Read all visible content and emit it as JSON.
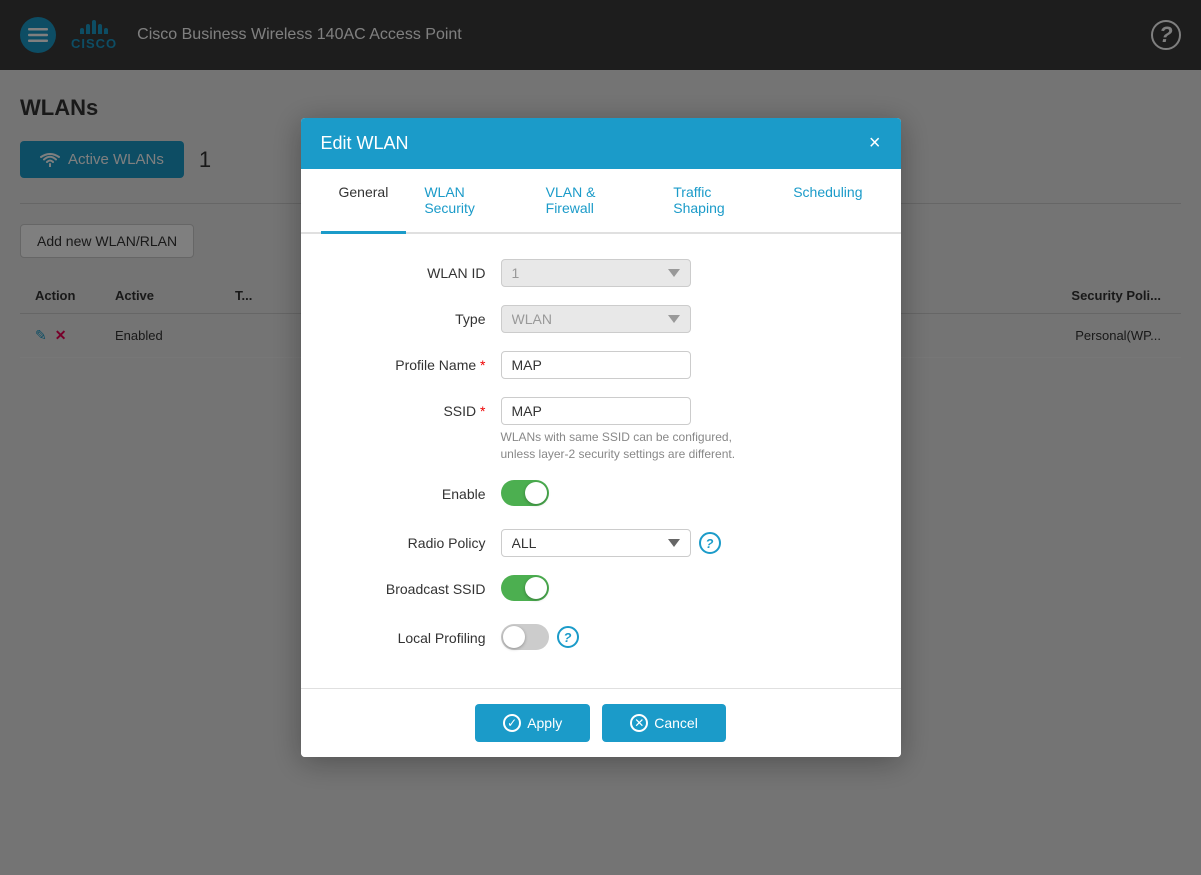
{
  "header": {
    "app_title": "Cisco Business Wireless 140AC Access Point",
    "menu_icon_label": "menu",
    "help_icon_label": "?"
  },
  "page": {
    "title": "WLANs",
    "active_wlans_label": "Active WLANs",
    "active_count": "1",
    "add_btn_label": "Add new WLAN/RLAN",
    "table": {
      "headers": [
        "Action",
        "Active",
        "T...",
        "Security Poli..."
      ],
      "row": {
        "active": "Enabled",
        "security": "Personal(WP..."
      }
    }
  },
  "modal": {
    "title": "Edit WLAN",
    "close_label": "×",
    "tabs": [
      {
        "label": "General",
        "active": true
      },
      {
        "label": "WLAN Security",
        "active": false
      },
      {
        "label": "VLAN & Firewall",
        "active": false
      },
      {
        "label": "Traffic Shaping",
        "active": false
      },
      {
        "label": "Scheduling",
        "active": false
      }
    ],
    "form": {
      "wlan_id_label": "WLAN ID",
      "wlan_id_value": "1",
      "type_label": "Type",
      "type_value": "WLAN",
      "profile_name_label": "Profile Name",
      "profile_name_value": "MAP",
      "ssid_label": "SSID",
      "ssid_value": "MAP",
      "ssid_hint": "WLANs with same SSID can be configured, unless layer-2 security settings are different.",
      "enable_label": "Enable",
      "enable_on": true,
      "radio_policy_label": "Radio Policy",
      "radio_policy_value": "ALL",
      "broadcast_ssid_label": "Broadcast SSID",
      "broadcast_ssid_on": true,
      "local_profiling_label": "Local Profiling",
      "local_profiling_on": false
    },
    "footer": {
      "apply_label": "Apply",
      "cancel_label": "Cancel"
    }
  }
}
